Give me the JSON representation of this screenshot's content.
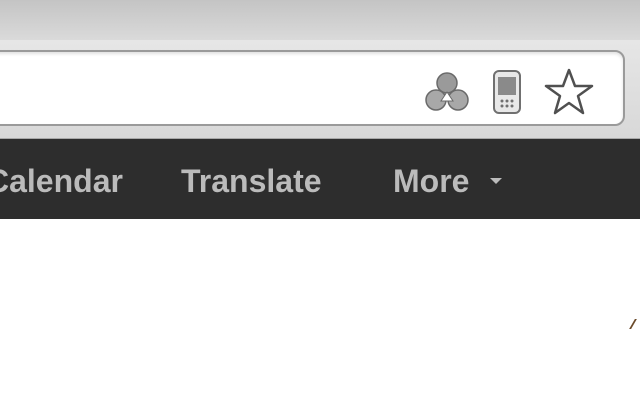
{
  "browser": {
    "toolbar": {
      "icons": [
        "extension-icon",
        "mobile-icon",
        "bookmark-star-icon"
      ]
    }
  },
  "navbar": {
    "items": [
      {
        "label": "Calendar"
      },
      {
        "label": "Translate"
      },
      {
        "label": "More"
      }
    ],
    "more_caret": "▾"
  },
  "colors": {
    "navbar_bg": "#2d2d2d",
    "nav_text": "#bbbbbb",
    "toolbar_bg": "#dcdcdc"
  }
}
